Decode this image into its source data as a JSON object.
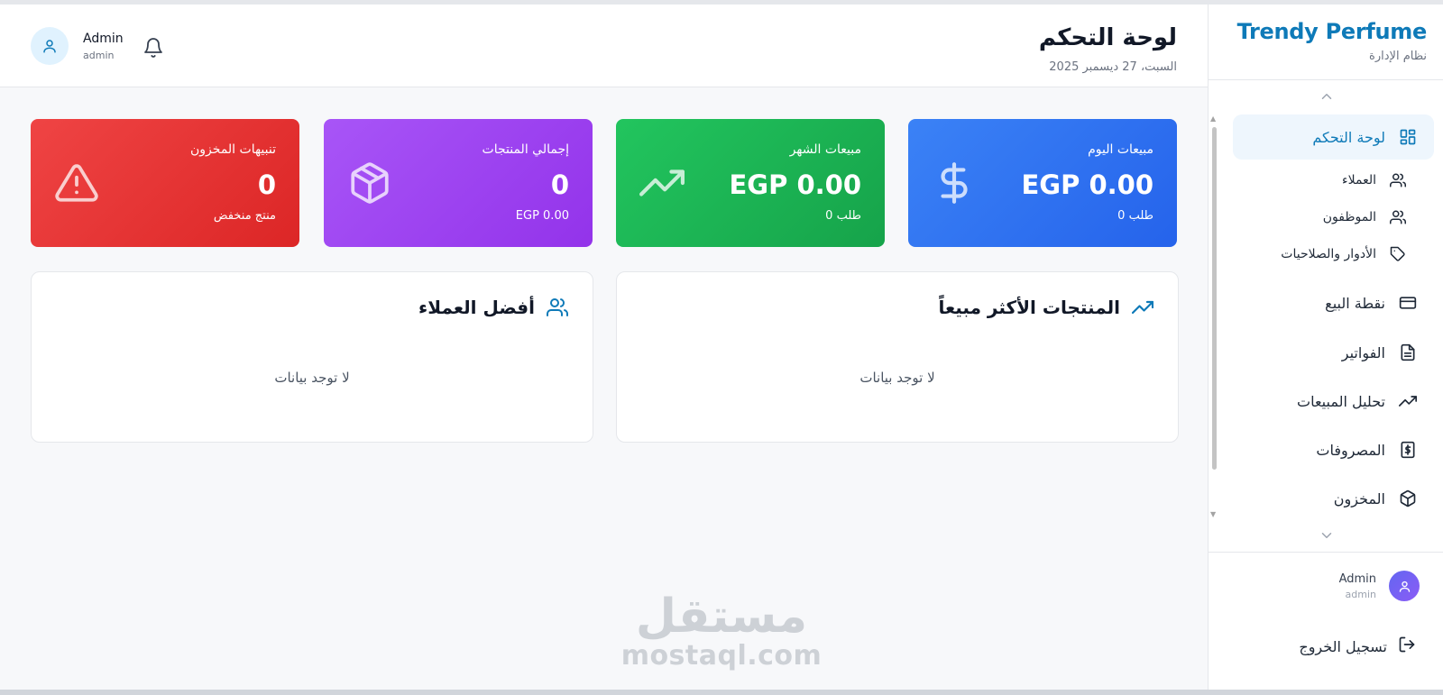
{
  "brand": {
    "title": "Trendy Perfume",
    "subtitle": "نظام الإدارة"
  },
  "sidebar": {
    "items": [
      {
        "label": "لوحة التحكم",
        "icon": "dashboard-icon",
        "active": true
      },
      {
        "label": "العملاء",
        "icon": "users-icon"
      },
      {
        "label": "الموظفون",
        "icon": "users-icon"
      },
      {
        "label": "الأدوار والصلاحيات",
        "icon": "tag-icon"
      },
      {
        "label": "نقطة البيع",
        "icon": "credit-card-icon"
      },
      {
        "label": "الفواتير",
        "icon": "file-text-icon"
      },
      {
        "label": "تحليل المبيعات",
        "icon": "trending-up-icon"
      },
      {
        "label": "المصروفات",
        "icon": "dollar-receipt-icon"
      },
      {
        "label": "المخزون",
        "icon": "package-icon"
      }
    ],
    "user": {
      "name": "Admin",
      "role": "admin"
    },
    "logout_label": "تسجيل الخروج"
  },
  "header": {
    "title": "لوحة التحكم",
    "date": "السبت، 27 ديسمبر 2025",
    "user": {
      "name": "Admin",
      "role": "admin"
    }
  },
  "stats": [
    {
      "label": "مبيعات اليوم",
      "value": "EGP 0.00",
      "sub": "0 طلب",
      "color": "#3b82f6",
      "icon": "dollar-icon"
    },
    {
      "label": "مبيعات الشهر",
      "value": "EGP 0.00",
      "sub": "0 طلب",
      "color": "#22c55e",
      "icon": "trending-up-icon"
    },
    {
      "label": "إجمالي المنتجات",
      "value": "0",
      "sub": "EGP 0.00",
      "color": "#a855f7",
      "icon": "package-icon"
    },
    {
      "label": "تنبيهات المخزون",
      "value": "0",
      "sub": "منتج منخفض",
      "color": "#ef4444",
      "icon": "alert-triangle-icon"
    }
  ],
  "panels": {
    "top_products": {
      "title": "المنتجات الأكثر مبيعاً",
      "empty": "لا توجد بيانات"
    },
    "top_customers": {
      "title": "أفضل العملاء",
      "empty": "لا توجد بيانات"
    }
  },
  "watermark": {
    "arabic": "مستقل",
    "latin": "mostaql.com"
  }
}
